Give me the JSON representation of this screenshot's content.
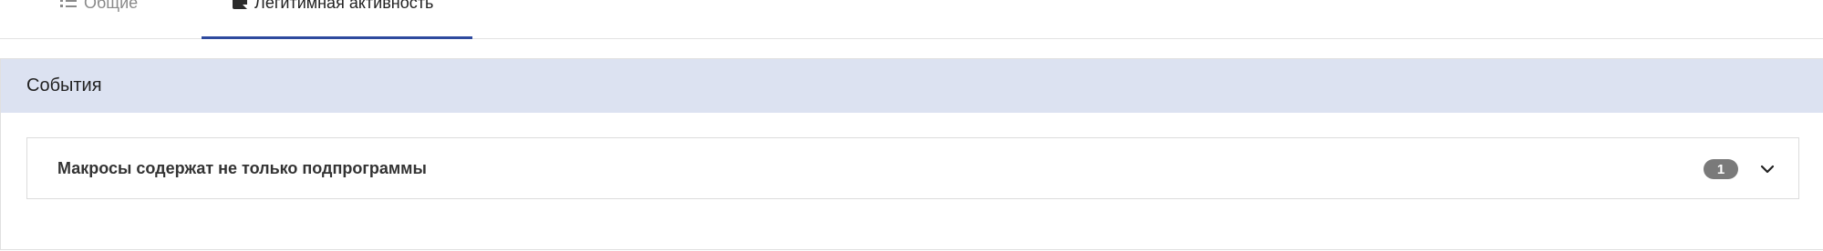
{
  "tabs": [
    {
      "label": "Общие",
      "icon": "list-icon",
      "active": false
    },
    {
      "label": "Легитимная активность",
      "icon": "note-icon",
      "active": true
    }
  ],
  "events_panel": {
    "title": "События",
    "items": [
      {
        "title": "Макросы содержат не только подпрограммы",
        "count": "1",
        "expand_icon": "chevron-down-icon"
      }
    ]
  },
  "colors": {
    "active_tab_underline": "#2e4a9e",
    "panel_header_bg": "#dce2f1",
    "badge_bg": "#7a7a7a"
  }
}
